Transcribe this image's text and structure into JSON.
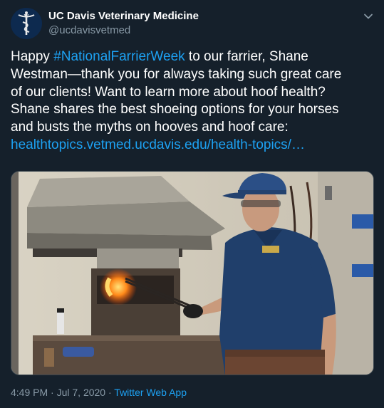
{
  "author": {
    "name": "UC Davis Veterinary Medicine",
    "handle": "@ucdavisvetmed",
    "avatar_icon": "caduceus-icon"
  },
  "tweet": {
    "line1_pre": "Happy ",
    "hashtag": "#NationalFarrierWeek",
    "line1_post": " to our farrier, Shane",
    "line2": "Westman—thank you for always taking such great care",
    "line3": "of our clients! Want to learn more about hoof health?",
    "line4": "Shane shares the best shoeing options for your horses",
    "line5": "and busts the myths on hooves and hoof care:",
    "link": "healthtopics.vetmed.ucdavis.edu/health-topics/…"
  },
  "footer": {
    "time": "4:49 PM",
    "sep1": " · ",
    "date": "Jul 7, 2020",
    "sep2": " · ",
    "source": "Twitter Web App"
  },
  "colors": {
    "background": "#15202b",
    "link": "#1da1f2",
    "secondary_text": "#8899a6"
  }
}
